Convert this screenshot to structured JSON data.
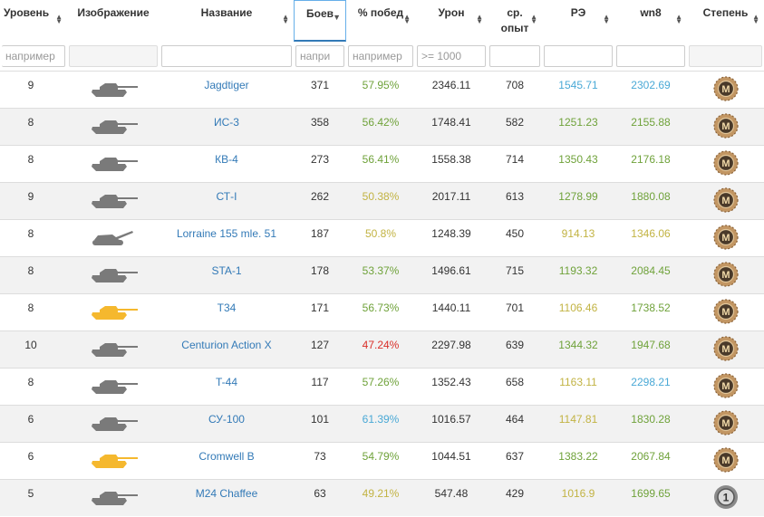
{
  "headers": [
    "Уровень",
    "Изображение",
    "Название",
    "Боев",
    "% побед",
    "Урон",
    "ср. опыт",
    "РЭ",
    "wn8",
    "Степень"
  ],
  "filters": [
    "например",
    "",
    "",
    "напри",
    "например",
    ">= 1000",
    "",
    "",
    "",
    ""
  ],
  "colors": {
    "green": "#6fa23a",
    "yellow": "#c2b343",
    "red": "#d9302a",
    "blue": "#4aa9d6",
    "link": "#337ab7",
    "tank_gray": "#7a7a7a",
    "tank_premium": "#f5b82e"
  },
  "rows": [
    {
      "tier": "9",
      "icon": "tank-icon",
      "premium": false,
      "name": "Jagdtiger",
      "battles": "371",
      "wins": "57.95%",
      "wins_c": "green",
      "dmg": "2346.11",
      "exp": "708",
      "re": "1545.71",
      "re_c": "blue",
      "wn8": "2302.69",
      "wn8_c": "blue",
      "medal": "mastery-badge-icon"
    },
    {
      "tier": "8",
      "icon": "tank-icon",
      "premium": false,
      "name": "ИС-3",
      "battles": "358",
      "wins": "56.42%",
      "wins_c": "green",
      "dmg": "1748.41",
      "exp": "582",
      "re": "1251.23",
      "re_c": "green",
      "wn8": "2155.88",
      "wn8_c": "green",
      "medal": "mastery-badge-icon"
    },
    {
      "tier": "8",
      "icon": "tank-icon",
      "premium": false,
      "name": "КВ-4",
      "battles": "273",
      "wins": "56.41%",
      "wins_c": "green",
      "dmg": "1558.38",
      "exp": "714",
      "re": "1350.43",
      "re_c": "green",
      "wn8": "2176.18",
      "wn8_c": "green",
      "medal": "mastery-badge-icon"
    },
    {
      "tier": "9",
      "icon": "tank-icon",
      "premium": false,
      "name": "СТ-I",
      "battles": "262",
      "wins": "50.38%",
      "wins_c": "yellow",
      "dmg": "2017.11",
      "exp": "613",
      "re": "1278.99",
      "re_c": "green",
      "wn8": "1880.08",
      "wn8_c": "green",
      "medal": "mastery-badge-icon"
    },
    {
      "tier": "8",
      "icon": "artillery-icon",
      "premium": false,
      "name": "Lorraine 155 mle. 51",
      "battles": "187",
      "wins": "50.8%",
      "wins_c": "yellow",
      "dmg": "1248.39",
      "exp": "450",
      "re": "914.13",
      "re_c": "yellow",
      "wn8": "1346.06",
      "wn8_c": "yellow",
      "medal": "mastery-badge-icon"
    },
    {
      "tier": "8",
      "icon": "tank-icon",
      "premium": false,
      "name": "STA-1",
      "battles": "178",
      "wins": "53.37%",
      "wins_c": "green",
      "dmg": "1496.61",
      "exp": "715",
      "re": "1193.32",
      "re_c": "green",
      "wn8": "2084.45",
      "wn8_c": "green",
      "medal": "mastery-badge-icon"
    },
    {
      "tier": "8",
      "icon": "tank-icon",
      "premium": true,
      "name": "T34",
      "battles": "171",
      "wins": "56.73%",
      "wins_c": "green",
      "dmg": "1440.11",
      "exp": "701",
      "re": "1106.46",
      "re_c": "yellow",
      "wn8": "1738.52",
      "wn8_c": "green",
      "medal": "mastery-badge-icon"
    },
    {
      "tier": "10",
      "icon": "tank-icon",
      "premium": false,
      "name": "Centurion Action X",
      "battles": "127",
      "wins": "47.24%",
      "wins_c": "red",
      "dmg": "2297.98",
      "exp": "639",
      "re": "1344.32",
      "re_c": "green",
      "wn8": "1947.68",
      "wn8_c": "green",
      "medal": "mastery-badge-icon"
    },
    {
      "tier": "8",
      "icon": "tank-icon",
      "premium": false,
      "name": "T-44",
      "battles": "117",
      "wins": "57.26%",
      "wins_c": "green",
      "dmg": "1352.43",
      "exp": "658",
      "re": "1163.11",
      "re_c": "yellow",
      "wn8": "2298.21",
      "wn8_c": "blue",
      "medal": "mastery-badge-icon"
    },
    {
      "tier": "6",
      "icon": "tank-icon",
      "premium": false,
      "name": "СУ-100",
      "battles": "101",
      "wins": "61.39%",
      "wins_c": "blue",
      "dmg": "1016.57",
      "exp": "464",
      "re": "1147.81",
      "re_c": "yellow",
      "wn8": "1830.28",
      "wn8_c": "green",
      "medal": "mastery-badge-icon"
    },
    {
      "tier": "6",
      "icon": "tank-icon",
      "premium": true,
      "name": "Cromwell B",
      "battles": "73",
      "wins": "54.79%",
      "wins_c": "green",
      "dmg": "1044.51",
      "exp": "637",
      "re": "1383.22",
      "re_c": "green",
      "wn8": "2067.84",
      "wn8_c": "green",
      "medal": "mastery-badge-icon"
    },
    {
      "tier": "5",
      "icon": "tank-icon",
      "premium": false,
      "name": "M24 Chaffee",
      "battles": "63",
      "wins": "49.21%",
      "wins_c": "yellow",
      "dmg": "547.48",
      "exp": "429",
      "re": "1016.9",
      "re_c": "yellow",
      "wn8": "1699.65",
      "wn8_c": "green",
      "medal": "first-class-badge-icon",
      "medal_text": "1"
    }
  ]
}
